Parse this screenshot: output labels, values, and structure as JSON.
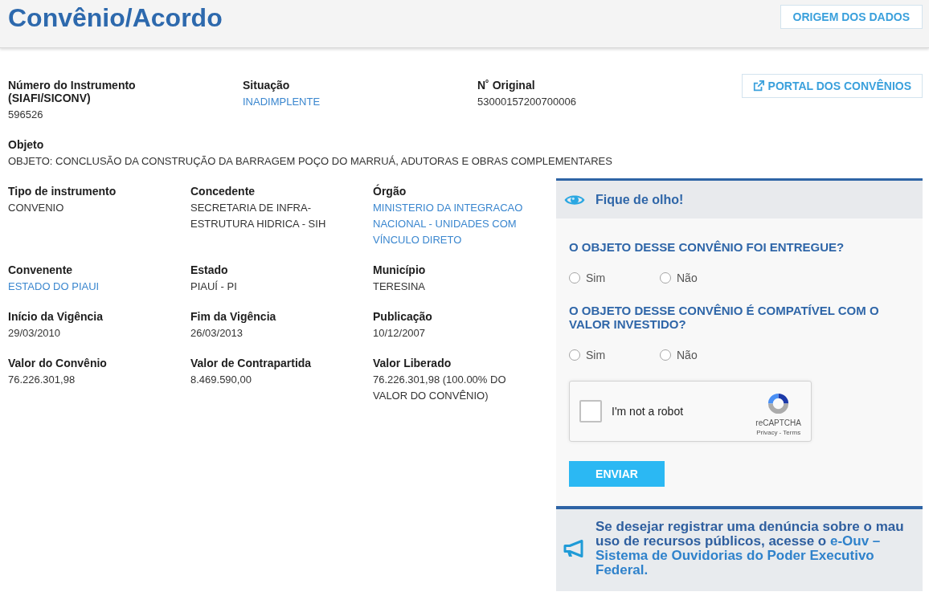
{
  "header": {
    "title": "Convênio/Acordo",
    "button": "ORIGEM DOS DADOS"
  },
  "summary": {
    "fields": [
      {
        "label": "Número do Instrumento\n(SIAFI/SICONV)",
        "value": "596526",
        "kind": "text"
      },
      {
        "label": "Situação",
        "value": "INADIMPLENTE",
        "kind": "link"
      },
      {
        "label": "N˚ Original",
        "value": "53000157200700006",
        "kind": "text"
      }
    ],
    "portal_button": "PORTAL DOS CONVÊNIOS"
  },
  "objeto": {
    "label": "Objeto",
    "value": "OBJETO: CONCLUSÃO DA CONSTRUÇÃO DA BARRAGEM POÇO DO MARRUÁ, ADUTORAS E OBRAS COMPLEMENTARES",
    "kind": "text"
  },
  "details": [
    {
      "label": "Tipo de instrumento",
      "value": "CONVENIO",
      "kind": "text"
    },
    {
      "label": "Concedente",
      "value": "SECRETARIA DE INFRA-ESTRUTURA HIDRICA - SIH",
      "kind": "text"
    },
    {
      "label": "Órgão",
      "value": "MINISTERIO DA INTEGRACAO NACIONAL - UNIDADES COM VÍNCULO DIRETO",
      "kind": "link"
    },
    {
      "label": "Convenente",
      "value": "ESTADO DO PIAUI",
      "kind": "link"
    },
    {
      "label": "Estado",
      "value": "PIAUÍ - PI",
      "kind": "text"
    },
    {
      "label": "Município",
      "value": "TERESINA",
      "kind": "text"
    },
    {
      "label": "Início da Vigência",
      "value": "29/03/2010",
      "kind": "text"
    },
    {
      "label": "Fim da Vigência",
      "value": "26/03/2013",
      "kind": "text"
    },
    {
      "label": "Publicação",
      "value": "10/12/2007",
      "kind": "text"
    },
    {
      "label": "Valor do Convênio",
      "value": "76.226.301,98",
      "kind": "text"
    },
    {
      "label": "Valor de Contrapartida",
      "value": "8.469.590,00",
      "kind": "text"
    },
    {
      "label": "Valor Liberado",
      "value": "76.226.301,98 (100.00% DO VALOR DO CONVÊNIO)",
      "kind": "text"
    }
  ],
  "alert_panel": {
    "title": "Fique de olho!",
    "questions": [
      {
        "text": "O OBJETO DESSE CONVÊNIO FOI ENTREGUE?",
        "options": [
          {
            "label": "Sim",
            "selected": false
          },
          {
            "label": "Não",
            "selected": false
          }
        ]
      },
      {
        "text": "O OBJETO DESSE CONVÊNIO É COMPATÍVEL COM O VALOR INVESTIDO?",
        "options": [
          {
            "label": "Sim",
            "selected": false
          },
          {
            "label": "Não",
            "selected": false
          }
        ]
      }
    ],
    "captcha": {
      "label": "I'm not a robot",
      "checked": false,
      "brand": "reCAPTCHA",
      "links": "Privacy - Terms"
    },
    "submit_button": "ENVIAR"
  },
  "report_notice": {
    "text": "Se desejar registrar uma denúncia sobre o mau uso de recursos públicos, acesse o",
    "link_lines": [
      "e-Ouv –",
      "Sistema de Ouvidorias do Poder Executivo",
      "Federal."
    ]
  }
}
